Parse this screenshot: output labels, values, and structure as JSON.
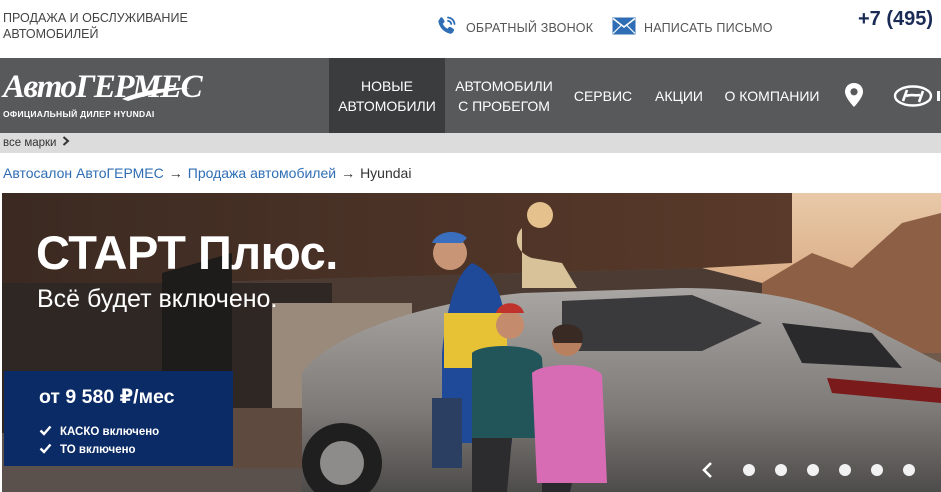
{
  "header": {
    "tagline": "ПРОДАЖА И ОБСЛУЖИВАНИЕ АВТОМОБИЛЕЙ",
    "callback_label": "ОБРАТНЫЙ ЗВОНОК",
    "callback_icon": "phone-icon",
    "mail_label": "НАПИСАТЬ ПИСЬМО",
    "mail_icon": "envelope-icon",
    "phone": "+7 (495)",
    "accent_color": "#2f6eb5"
  },
  "logo": {
    "name": "АвтоГЕРМЕС",
    "subtitle": "ОФИЦИАЛЬНЫЙ ДИЛЕР HYUNDAI"
  },
  "nav": {
    "background": "#58595b",
    "items": [
      {
        "label": "НОВЫЕ АВТОМОБИЛИ",
        "active": true
      },
      {
        "label": "АВТОМОБИЛИ С ПРОБЕГОМ",
        "active": false
      },
      {
        "label": "СЕРВИС",
        "active": false
      },
      {
        "label": "АКЦИИ",
        "active": false
      },
      {
        "label": "О КОМПАНИИ",
        "active": false
      }
    ],
    "location_icon": "map-pin-icon",
    "brand_icon": "hyundai-logo-icon"
  },
  "brand_strip": {
    "label": "все марки",
    "icon": "chevron-right-icon"
  },
  "breadcrumb": {
    "items": [
      {
        "label": "Автосалон АвтоГЕРМЕС",
        "link": true
      },
      {
        "label": "Продажа автомобилей",
        "link": true
      },
      {
        "label": "Hyundai",
        "link": false
      }
    ],
    "separator": "→"
  },
  "hero": {
    "title": "СТАРТ Плюс.",
    "subtitle": "Всё будет включено.",
    "offer_price": "от 9 580 ₽/мес",
    "offer_lines": [
      "КАСКО включено",
      "ТО включено"
    ],
    "offer_color": "#0b2b66",
    "slider": {
      "prev_icon": "chevron-left-icon",
      "dot_count": 6
    }
  }
}
